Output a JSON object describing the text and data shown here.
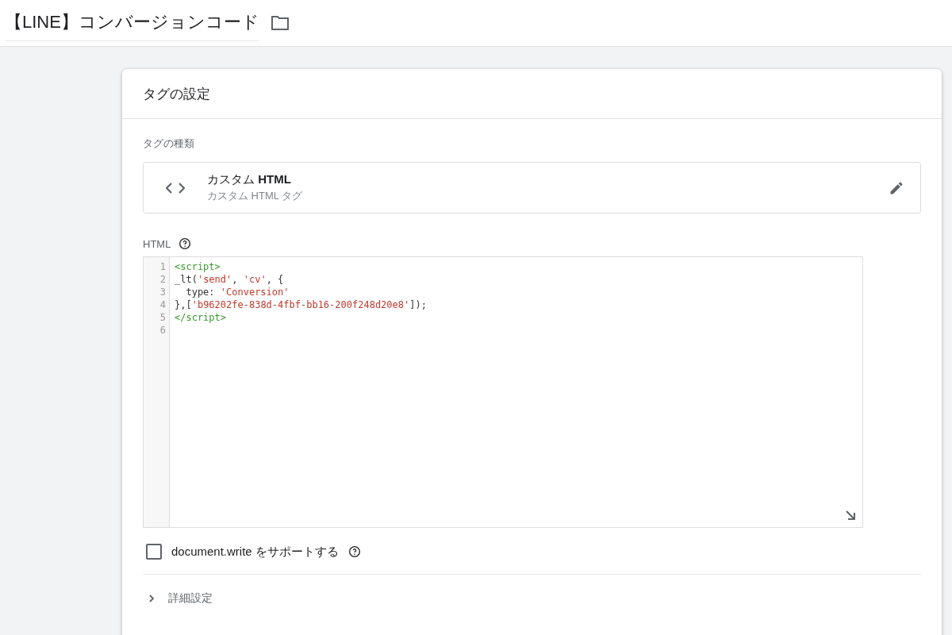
{
  "header": {
    "title": "【LINE】コンバージョンコード"
  },
  "card": {
    "title": "タグの設定",
    "tag_type": {
      "label": "タグの種類",
      "name": "カスタム **HTML**",
      "description": "カスタム HTML タグ"
    },
    "html": {
      "label": "HTML",
      "lines": [
        {
          "number": "1",
          "tokens": [
            {
              "text": "<script>",
              "kind": "tag"
            }
          ]
        },
        {
          "number": "2",
          "tokens": [
            {
              "text": "_lt(",
              "kind": "plain"
            },
            {
              "text": "'send'",
              "kind": "string"
            },
            {
              "text": ", ",
              "kind": "plain"
            },
            {
              "text": "'cv'",
              "kind": "string"
            },
            {
              "text": ", {",
              "kind": "plain"
            }
          ]
        },
        {
          "number": "3",
          "tokens": [
            {
              "text": "  type: ",
              "kind": "plain"
            },
            {
              "text": "'Conversion'",
              "kind": "string"
            }
          ]
        },
        {
          "number": "4",
          "tokens": [
            {
              "text": "},[",
              "kind": "plain"
            },
            {
              "text": "'b96202fe-838d-4fbf-bb16-200f248d20e8'",
              "kind": "string"
            },
            {
              "text": "]);",
              "kind": "plain"
            }
          ]
        },
        {
          "number": "5",
          "tokens": [
            {
              "text": "</script>",
              "kind": "tag"
            }
          ]
        },
        {
          "number": "6"
        }
      ]
    },
    "document_write": {
      "label": "document.write をサポートする",
      "checked": false
    },
    "advanced": {
      "label": "詳細設定",
      "expanded": false
    }
  }
}
